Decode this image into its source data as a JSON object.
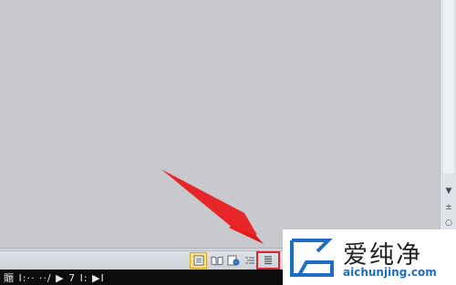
{
  "scrollbar": {
    "down_glyph": "▼",
    "prev_glyph": "±",
    "browse_glyph": "○"
  },
  "status_bar": {
    "view_buttons": [
      {
        "name": "print-layout-view-button",
        "state": "active"
      },
      {
        "name": "full-screen-reading-view-button",
        "state": "normal"
      },
      {
        "name": "web-layout-view-button",
        "state": "normal"
      },
      {
        "name": "outline-view-button",
        "state": "normal"
      },
      {
        "name": "draft-view-button",
        "state": "highlighted"
      }
    ]
  },
  "taskbar": {
    "text": "䞅 Ⅰ:··   ··/ ▶ 7 Ⅰ: ▶Ⅰ"
  },
  "watermark": {
    "title": "爱纯净",
    "url": "aichunjing.com"
  },
  "colors": {
    "annotation_red": "#e0262b",
    "active_view": "#fbe18a",
    "watermark_blue": "#1e6fc4"
  }
}
